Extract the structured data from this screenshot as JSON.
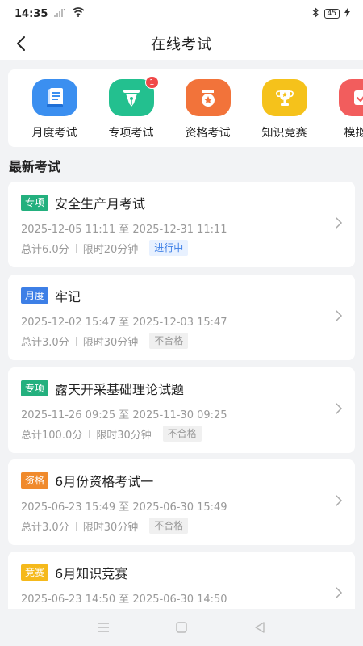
{
  "status_bar": {
    "time": "14:35",
    "battery": "45"
  },
  "nav": {
    "title": "在线考试"
  },
  "categories": [
    {
      "label": "月度考试",
      "icon": "document-icon",
      "color": "#3b8ff0",
      "badge": ""
    },
    {
      "label": "专项考试",
      "icon": "pen-nib-icon",
      "color": "#23c08f",
      "badge": "1"
    },
    {
      "label": "资格考试",
      "icon": "medal-star-icon",
      "color": "#f2733a",
      "badge": ""
    },
    {
      "label": "知识竞赛",
      "icon": "trophy-icon",
      "color": "#f5c21b",
      "badge": ""
    },
    {
      "label": "模拟考",
      "icon": "checkbox-icon",
      "color": "#f25d5d",
      "badge": ""
    }
  ],
  "section": {
    "title": "最新考试"
  },
  "exams": [
    {
      "tag": "专项",
      "tag_color": "#23b07e",
      "title": "安全生产月考试",
      "time": "2025-12-05 11:11 至 2025-12-31 11:11",
      "score": "总计6.0分",
      "limit": "限时20分钟",
      "status": "进行中",
      "status_type": "active"
    },
    {
      "tag": "月度",
      "tag_color": "#3d7fe6",
      "title": "牢记",
      "time": "2025-12-02 15:47 至 2025-12-03 15:47",
      "score": "总计3.0分",
      "limit": "限时30分钟",
      "status": "不合格",
      "status_type": "fail"
    },
    {
      "tag": "专项",
      "tag_color": "#23b07e",
      "title": "露天开采基础理论试题",
      "time": "2025-11-26 09:25 至 2025-11-30 09:25",
      "score": "总计100.0分",
      "limit": "限时30分钟",
      "status": "不合格",
      "status_type": "fail"
    },
    {
      "tag": "资格",
      "tag_color": "#f08a2c",
      "title": "6月份资格考试一",
      "time": "2025-06-23 15:49 至 2025-06-30 15:49",
      "score": "总计3.0分",
      "limit": "限时30分钟",
      "status": "不合格",
      "status_type": "fail"
    },
    {
      "tag": "竞赛",
      "tag_color": "#f5b91b",
      "title": "6月知识竞赛",
      "time": "2025-06-23 14:50 至 2025-06-30 14:50",
      "score": "",
      "limit": "",
      "status": "",
      "status_type": ""
    }
  ]
}
